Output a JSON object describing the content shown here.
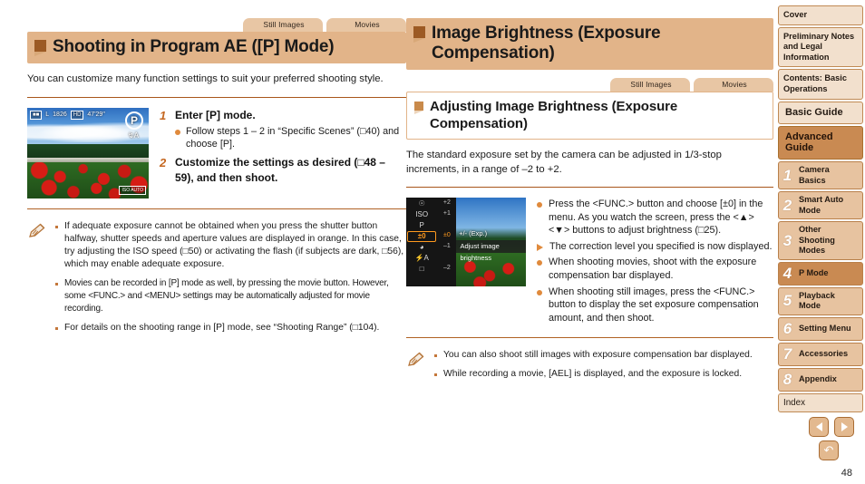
{
  "left": {
    "tabs": [
      "Still Images",
      "Movies"
    ],
    "heading": "Shooting in Program AE ([P] Mode)",
    "intro": "You can customize many function settings to suit your preferred shooting style.",
    "screenshot": {
      "osd_mode": "P",
      "osd_quality": "L",
      "osd_shots": "1826",
      "osd_time": "47'29\"",
      "osd_flash": "↯A",
      "osd_iso": "ISO AUTO"
    },
    "steps": [
      {
        "num": "1",
        "title": "Enter [P] mode.",
        "bullets": [
          "Follow steps 1 – 2 in “Specific Scenes” (□40) and choose [P]."
        ]
      },
      {
        "num": "2",
        "title": "Customize the settings as desired (□48 – 59), and then shoot.",
        "bullets": []
      }
    ],
    "notes": [
      "If adequate exposure cannot be obtained when you press the shutter button halfway, shutter speeds and aperture values are displayed in orange. In this case, try adjusting the ISO speed (□50) or activating the flash (if subjects are dark, □56), which may enable adequate exposure.",
      "Movies can be recorded in [P] mode as well, by pressing the movie button. However, some <FUNC.> and <MENU> settings may be automatically adjusted for movie recording.",
      "For details on the shooting range in [P] mode, see “Shooting Range” (□104)."
    ]
  },
  "right": {
    "heading": "Image Brightness (Exposure Compensation)",
    "tabs": [
      "Still Images",
      "Movies"
    ],
    "subheading": "Adjusting Image Brightness (Exposure Compensation)",
    "intro": "The standard exposure set by the camera can be adjusted in 1/3-stop increments, in a range of –2 to +2.",
    "screenshot": {
      "selected_item": "±0",
      "exp_tag": "+/- (Exp.)",
      "tip": "Adjust image brightness",
      "scale": [
        "+2",
        "+1",
        "±0",
        "–1",
        "–2"
      ]
    },
    "bullets": [
      {
        "type": "dot",
        "text": "Press the <FUNC.> button and choose [±0] in the menu. As you watch the screen, press the <▲><▼> buttons to adjust brightness (□25)."
      },
      {
        "type": "tri",
        "text": "The correction level you specified is now displayed."
      },
      {
        "type": "dot",
        "text": "When shooting movies, shoot with the exposure compensation bar displayed."
      },
      {
        "type": "dot",
        "text": "When shooting still images, press the <FUNC.> button to display the set exposure compensation amount, and then shoot."
      }
    ],
    "notes": [
      "You can also shoot still images with exposure compensation bar displayed.",
      "While recording a movie, [AEL] is displayed, and the exposure is locked."
    ]
  },
  "sidebar": {
    "items": [
      {
        "label": "Cover",
        "style": "plain"
      },
      {
        "label": "Preliminary Notes and Legal Information",
        "style": "plain"
      },
      {
        "label": "Contents: Basic Operations",
        "style": "plain"
      },
      {
        "label": "Basic Guide",
        "style": "big"
      },
      {
        "label": "Advanced Guide",
        "style": "guide"
      }
    ],
    "chapters": [
      {
        "num": "1",
        "label": "Camera Basics",
        "active": false
      },
      {
        "num": "2",
        "label": "Smart Auto Mode",
        "active": false
      },
      {
        "num": "3",
        "label": "Other Shooting Modes",
        "active": false
      },
      {
        "num": "4",
        "label": "P Mode",
        "active": true
      },
      {
        "num": "5",
        "label": "Playback Mode",
        "active": false
      },
      {
        "num": "6",
        "label": "Setting Menu",
        "active": false
      },
      {
        "num": "7",
        "label": "Accessories",
        "active": false
      },
      {
        "num": "8",
        "label": "Appendix",
        "active": false
      }
    ],
    "index_label": "Index"
  },
  "pagenav": {
    "prev_icon": "left-arrow-icon",
    "next_icon": "right-arrow-icon",
    "return_icon": "↶",
    "page_number": "48"
  }
}
